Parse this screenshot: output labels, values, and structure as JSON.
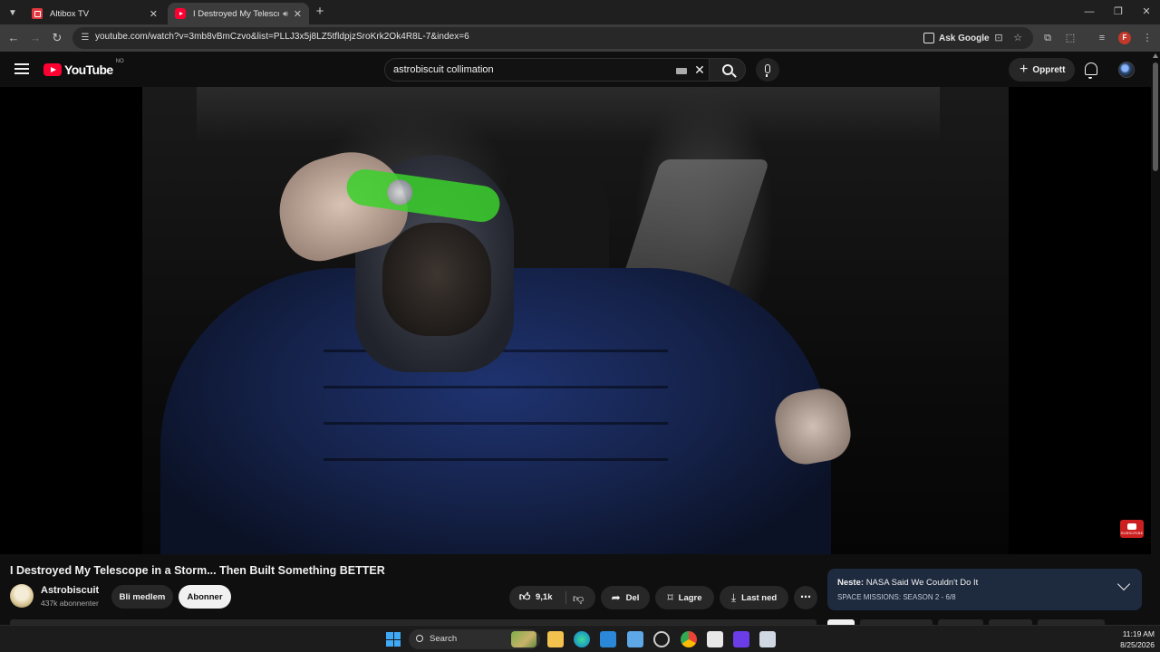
{
  "browser": {
    "tabs": [
      {
        "title": "Altibox TV",
        "active": false
      },
      {
        "title": "I Destroyed My Telescope in a Storm... Then Built Something BETTER",
        "active": true
      }
    ],
    "url": "youtube.com/watch?v=3mb8vBmCzvo&list=PLLJ3x5j8LZ5tfldpjzSroKrk2Ok4R8L-7&index=6",
    "ask_google_label": "Ask Google",
    "profile_initial": "F"
  },
  "youtube": {
    "logo_text": "YouTube",
    "country_code": "NO",
    "search": {
      "value": "astrobiscuit collimation"
    },
    "create_label": "Opprett"
  },
  "video": {
    "title": "I Destroyed My Telescope in a Storm... Then Built Something BETTER",
    "watermark_text": "SUBSCRIBE"
  },
  "channel": {
    "name": "Astrobiscuit",
    "subscribers": "437k abonnenter",
    "join_label": "Bli medlem",
    "subscribe_label": "Abonner"
  },
  "actions": {
    "likes": "9,1k",
    "share_label": "Del",
    "save_label": "Lagre",
    "download_label": "Last ned"
  },
  "up_next": {
    "prefix": "Neste:",
    "title": "NASA Said We Couldn't Do It",
    "playlist": "SPACE MISSIONS: SEASON 2 - 6/8"
  },
  "taskbar": {
    "search_label": "Search",
    "time": "11:19 AM",
    "date": "8/25/2026"
  },
  "colors": {
    "youtube_red": "#ff0033",
    "background": "#0f0f0f",
    "pill": "#272727",
    "next_card": "#1e2a3e"
  },
  "icons": [
    "tab-search-icon",
    "speaker-icon",
    "back-icon",
    "forward-icon",
    "reload-icon",
    "site-info-icon",
    "install-icon",
    "star-icon",
    "extensions-icon",
    "menu-icon",
    "hamburger-icon",
    "keyboard-icon",
    "search-icon",
    "mic-icon",
    "bell-icon",
    "thumbs-up-icon",
    "thumbs-down-icon",
    "share-icon",
    "bookmark-icon",
    "download-icon",
    "more-icon",
    "chevron-down-icon",
    "windows-icon"
  ]
}
